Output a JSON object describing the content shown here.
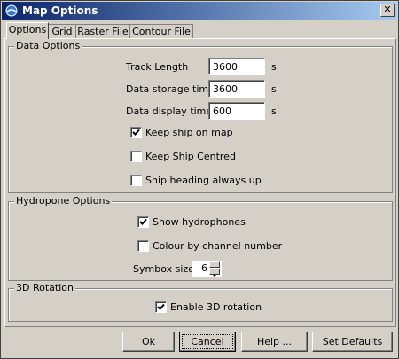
{
  "window": {
    "title": "Map Options",
    "close_label": "✕"
  },
  "tabs": [
    {
      "label": "Options",
      "active": true
    },
    {
      "label": "Grid",
      "active": false
    },
    {
      "label": "Raster File",
      "active": false
    },
    {
      "label": "Contour File",
      "active": false
    }
  ],
  "data_options": {
    "title": "Data Options",
    "track_length": {
      "label": "Track Length",
      "value": "3600",
      "unit": "s"
    },
    "storage_time": {
      "label": "Data storage time",
      "value": "3600",
      "unit": "s"
    },
    "display_time": {
      "label": "Data display time",
      "value": "600",
      "unit": "s"
    },
    "keep_ship_on_map": {
      "label": "Keep ship on map",
      "checked": true
    },
    "keep_ship_centred": {
      "label": "Keep Ship Centred",
      "checked": false
    },
    "ship_heading_up": {
      "label": "Ship heading always up",
      "checked": false
    }
  },
  "hydrophone_options": {
    "title": "Hydropone Options",
    "show_hydrophones": {
      "label": "Show hydrophones",
      "checked": true
    },
    "colour_by_channel": {
      "label": "Colour by channel number",
      "checked": false
    },
    "symbol_size": {
      "label": "Symbox size",
      "value": "6"
    }
  },
  "rotation": {
    "title": "3D Rotation",
    "enable_3d": {
      "label": "Enable 3D rotation",
      "checked": true
    }
  },
  "buttons": {
    "ok": "Ok",
    "cancel": "Cancel",
    "help": "Help ...",
    "defaults": "Set Defaults"
  }
}
